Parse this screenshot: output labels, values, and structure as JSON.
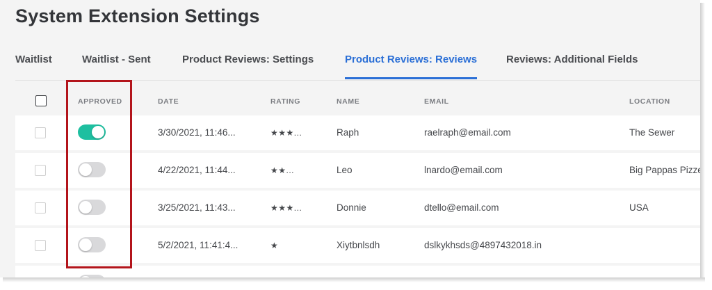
{
  "page_title": "System Extension Settings",
  "tabs": [
    {
      "label": "Waitlist",
      "active": false
    },
    {
      "label": "Waitlist - Sent",
      "active": false
    },
    {
      "label": "Product Reviews: Settings",
      "active": false
    },
    {
      "label": "Product Reviews: Reviews",
      "active": true
    },
    {
      "label": "Reviews: Additional Fields",
      "active": false
    }
  ],
  "colors": {
    "accent": "#2b6fd6",
    "toggle_on": "#1ebfa0",
    "toggle_off": "#d9d9db",
    "highlight": "#b3141b"
  },
  "table": {
    "columns": [
      "APPROVED",
      "DATE",
      "RATING",
      "NAME",
      "EMAIL",
      "LOCATION"
    ],
    "rows": [
      {
        "approved": true,
        "date": "3/30/2021, 11:46...",
        "rating": "★★★...",
        "name": "Raph",
        "email": "raelraph@email.com",
        "location": "The Sewer"
      },
      {
        "approved": false,
        "date": "4/22/2021, 11:44...",
        "rating": "★★...",
        "name": "Leo",
        "email": "lnardo@email.com",
        "location": "Big Pappas Pizze"
      },
      {
        "approved": false,
        "date": "3/25/2021, 11:43...",
        "rating": "★★★...",
        "name": "Donnie",
        "email": "dtello@email.com",
        "location": "USA"
      },
      {
        "approved": false,
        "date": "5/2/2021, 11:41:4...",
        "rating": "★",
        "name": "Xiytbnlsdh",
        "email": "dslkykhsds@4897432018.in",
        "location": ""
      },
      {
        "approved": false,
        "date": "",
        "rating": "",
        "name": "",
        "email": "",
        "location": ""
      }
    ]
  }
}
